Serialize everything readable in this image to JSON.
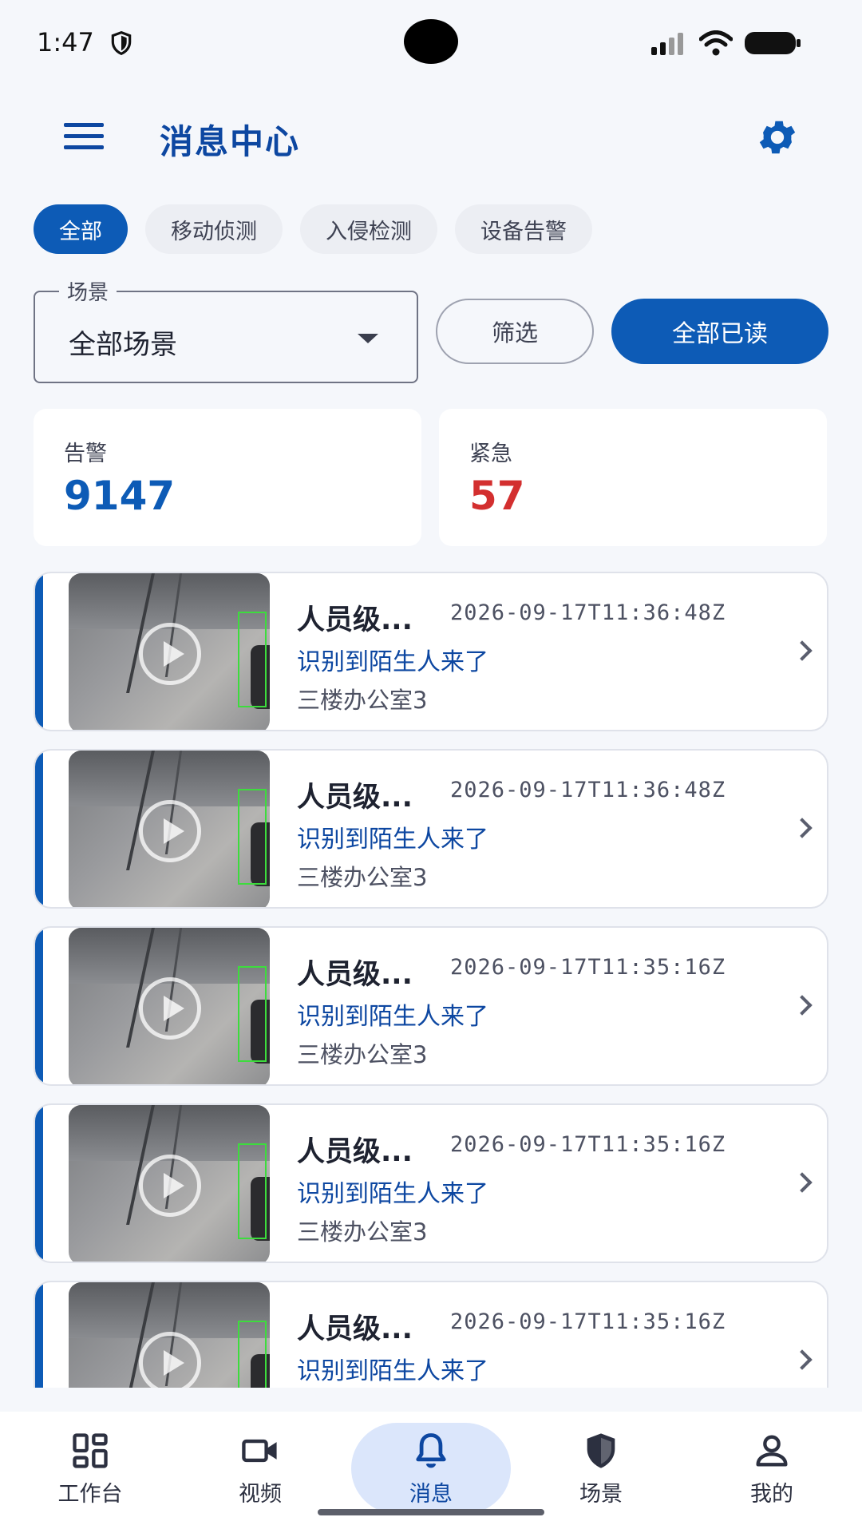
{
  "status_bar": {
    "time": "1:47"
  },
  "app_bar": {
    "title": "消息中心"
  },
  "tabs": [
    {
      "label": "全部",
      "active": true
    },
    {
      "label": "移动侦测",
      "active": false
    },
    {
      "label": "入侵检测",
      "active": false
    },
    {
      "label": "设备告警",
      "active": false
    }
  ],
  "filter": {
    "scene_label": "场景",
    "scene_value": "全部场景",
    "filter_button": "筛选",
    "read_all_button": "全部已读"
  },
  "stats": {
    "alarm_label": "告警",
    "alarm_value": "9147",
    "urgent_label": "紧急",
    "urgent_value": "57"
  },
  "messages": [
    {
      "title": "人员级...",
      "time": "2026-09-17T11:36:48Z",
      "desc": "识别到陌生人来了",
      "location": "三楼办公室3"
    },
    {
      "title": "人员级...",
      "time": "2026-09-17T11:36:48Z",
      "desc": "识别到陌生人来了",
      "location": "三楼办公室3"
    },
    {
      "title": "人员级...",
      "time": "2026-09-17T11:35:16Z",
      "desc": "识别到陌生人来了",
      "location": "三楼办公室3"
    },
    {
      "title": "人员级...",
      "time": "2026-09-17T11:35:16Z",
      "desc": "识别到陌生人来了",
      "location": "三楼办公室3"
    },
    {
      "title": "人员级...",
      "time": "2026-09-17T11:35:16Z",
      "desc": "识别到陌生人来了",
      "location": ""
    }
  ],
  "bottom_nav": [
    {
      "label": "工作台",
      "icon": "dashboard-icon",
      "active": false
    },
    {
      "label": "视频",
      "icon": "video-camera-icon",
      "active": false
    },
    {
      "label": "消息",
      "icon": "bell-icon",
      "active": true
    },
    {
      "label": "场景",
      "icon": "shield-icon",
      "active": false
    },
    {
      "label": "我的",
      "icon": "person-icon",
      "active": false
    }
  ],
  "colors": {
    "primary": "#0d5bb6",
    "urgent": "#d32f2f",
    "title": "#0d47a1"
  }
}
